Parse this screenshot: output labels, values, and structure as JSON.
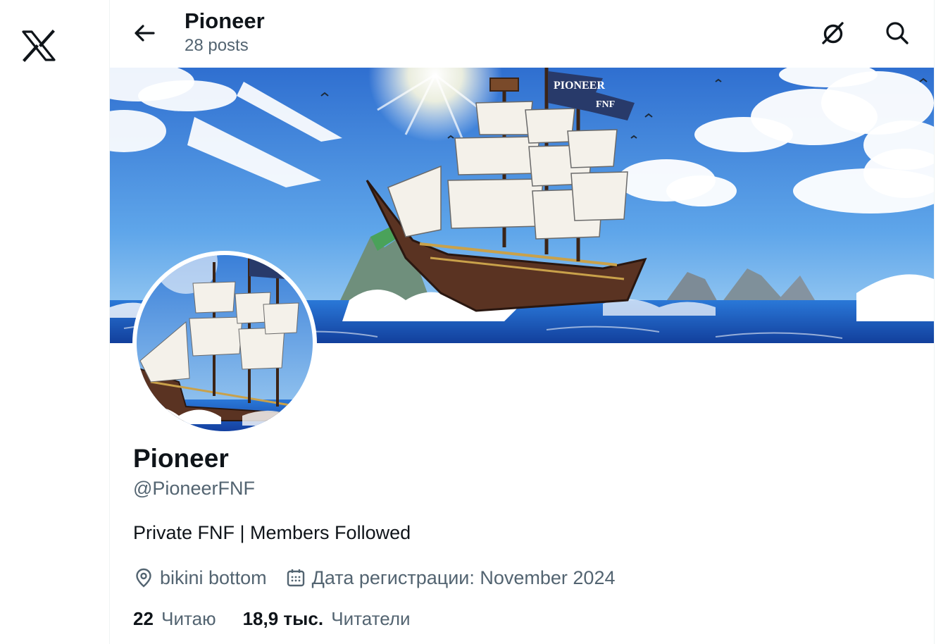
{
  "app": {
    "logo_icon": "x-logo-icon"
  },
  "header": {
    "back_icon": "arrow-left-icon",
    "title": "Pioneer",
    "posts_count": "28 posts",
    "grok_icon": "grok-icon",
    "search_icon": "search-icon"
  },
  "banner": {
    "flag_text_line1": "PIONEER",
    "flag_text_line2": "FNF"
  },
  "profile": {
    "name": "Pioneer",
    "handle": "@PioneerFNF",
    "bio": "Private FNF | Members Followed",
    "location_icon": "location-pin-icon",
    "location": "bikini bottom",
    "joined_icon": "calendar-icon",
    "joined": "Дата регистрации: November 2024"
  },
  "stats": {
    "following_count": "22",
    "following_label": "Читаю",
    "followers_count": "18,9 тыс.",
    "followers_label": "Читатели"
  },
  "colors": {
    "text_primary": "#0f1419",
    "text_secondary": "#536471",
    "sky": "#3d8de0",
    "sea": "#1f5fc8"
  }
}
